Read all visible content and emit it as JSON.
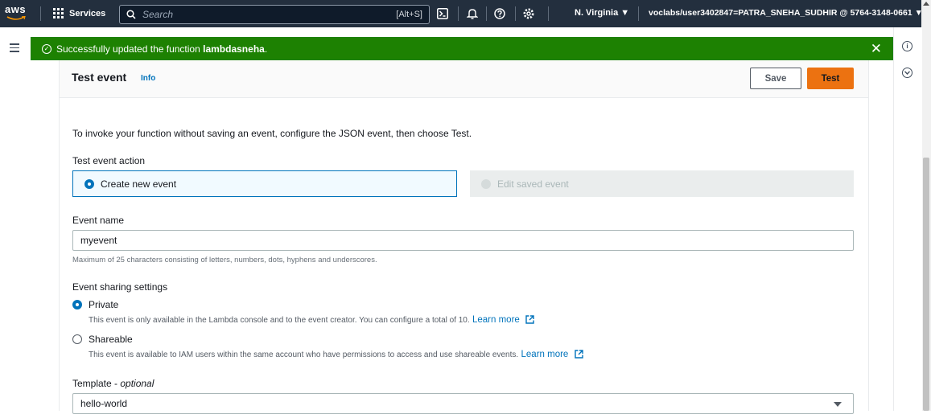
{
  "topnav": {
    "logo": "aws",
    "services_label": "Services",
    "search_placeholder": "Search",
    "search_shortcut": "[Alt+S]",
    "region": "N. Virginia ▼",
    "account": "voclabs/user3402847=PATRA_SNEHA_SUDHIR @ 5764-3148-0661 ▼",
    "icons": [
      "cloudshell-icon",
      "bell-icon",
      "help-icon",
      "settings-icon"
    ]
  },
  "flash": {
    "message_prefix": "Successfully updated the function ",
    "function_name": "lambdasneha",
    "message_suffix": "."
  },
  "panel": {
    "title": "Test event",
    "info_link": "Info",
    "save_label": "Save",
    "test_label": "Test"
  },
  "form": {
    "intro": "To invoke your function without saving an event, configure the JSON event, then choose Test.",
    "action_label": "Test event action",
    "action_options": [
      {
        "label": "Create new event",
        "selected": true
      },
      {
        "label": "Edit saved event",
        "selected": false,
        "disabled": true
      }
    ],
    "event_name_label": "Event name",
    "event_name_value": "myevent",
    "event_name_hint": "Maximum of 25 characters consisting of letters, numbers, dots, hyphens and underscores.",
    "sharing_label": "Event sharing settings",
    "private_label": "Private",
    "private_desc": "This event is only available in the Lambda console and to the event creator. You can configure a total of 10.",
    "shareable_label": "Shareable",
    "shareable_desc": "This event is available to IAM users within the same account who have permissions to access and use shareable events.",
    "learn_more": "Learn more",
    "template_label": "Template - ",
    "template_optional": "optional",
    "template_value": "hello-world"
  },
  "colors": {
    "nav_bg": "#232f3e",
    "flash_green": "#1d8102",
    "primary_orange": "#ec7211",
    "link_blue": "#0073bb"
  }
}
